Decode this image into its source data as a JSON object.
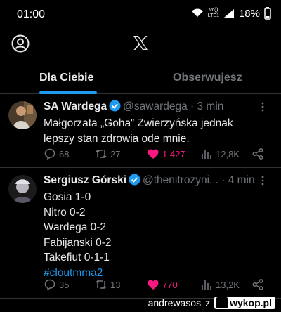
{
  "status_bar": {
    "time": "01:00",
    "network_top": "Vo))",
    "network_bottom": "LTE1",
    "battery": "18%"
  },
  "tabs": [
    {
      "label": "Dla Ciebie",
      "active": true
    },
    {
      "label": "Obserwujesz",
      "active": false
    }
  ],
  "tweets": [
    {
      "name": "SA Wardega",
      "handle": "@sawardega",
      "time": "· 3 min",
      "lines": [
        "Małgorzata „Goha” Zwierzyńska jednak",
        "lepszy stan zdrowia ode mnie."
      ],
      "replies": "68",
      "retweets": "27",
      "likes": "1 427",
      "views": "12,8K"
    },
    {
      "name": "Sergiusz Górski",
      "handle": "@thenitrozyni...",
      "time": "· 4 min",
      "lines": [
        "Gosia 1-0",
        "Nitro 0-2",
        "Wardega 0-2",
        "Fabijanski 0-2",
        "Takefiut 0-1-1"
      ],
      "hashtag": "#cloutmma2",
      "replies": "35",
      "retweets": "13",
      "likes": "770",
      "views": "13,2K"
    }
  ],
  "watermark": {
    "user": "andrewasos",
    "suffix": "z",
    "site": "wykop.pl"
  },
  "colors": {
    "accent": "#1d9bf0",
    "like": "#f91880",
    "muted": "#71767b",
    "divider": "#2f3336"
  }
}
